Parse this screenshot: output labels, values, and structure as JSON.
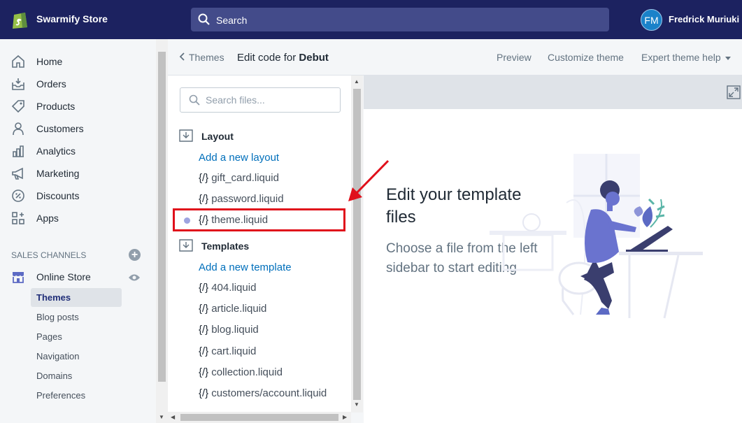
{
  "topbar": {
    "store_name": "Swarmify Store",
    "search_label": "Search",
    "avatar_initials": "FM",
    "user_name": "Fredrick Muriuki"
  },
  "sidebar": {
    "items": [
      {
        "label": "Home",
        "icon": "home-icon"
      },
      {
        "label": "Orders",
        "icon": "orders-icon"
      },
      {
        "label": "Products",
        "icon": "tag-icon"
      },
      {
        "label": "Customers",
        "icon": "person-icon"
      },
      {
        "label": "Analytics",
        "icon": "bar-chart-icon"
      },
      {
        "label": "Marketing",
        "icon": "megaphone-icon"
      },
      {
        "label": "Discounts",
        "icon": "discount-icon"
      },
      {
        "label": "Apps",
        "icon": "apps-icon"
      }
    ],
    "sales_channels_header": "SALES CHANNELS",
    "online_store_label": "Online Store",
    "sub_items": [
      "Themes",
      "Blog posts",
      "Pages",
      "Navigation",
      "Domains",
      "Preferences"
    ]
  },
  "theme_header": {
    "back_label": "Themes",
    "edit_prefix": "Edit code for ",
    "theme_name": "Debut",
    "preview": "Preview",
    "customize": "Customize theme",
    "expert_help": "Expert theme help"
  },
  "file_tree": {
    "search_placeholder": "Search files...",
    "layout": {
      "label": "Layout",
      "add_link": "Add a new layout",
      "files": [
        "gift_card.liquid",
        "password.liquid",
        "theme.liquid"
      ]
    },
    "templates": {
      "label": "Templates",
      "add_link": "Add a new template",
      "files": [
        "404.liquid",
        "article.liquid",
        "blog.liquid",
        "cart.liquid",
        "collection.liquid",
        "customers/account.liquid"
      ]
    },
    "code_glyph": "{/}",
    "selected_file": "theme.liquid"
  },
  "editor": {
    "empty_title": "Edit your template files",
    "empty_text": "Choose a file from the left sidebar to start editing"
  },
  "colors": {
    "topbar": "#1c2260",
    "link": "#006fbb",
    "highlight": "#e0101b",
    "accent": "#5c6ac4"
  }
}
